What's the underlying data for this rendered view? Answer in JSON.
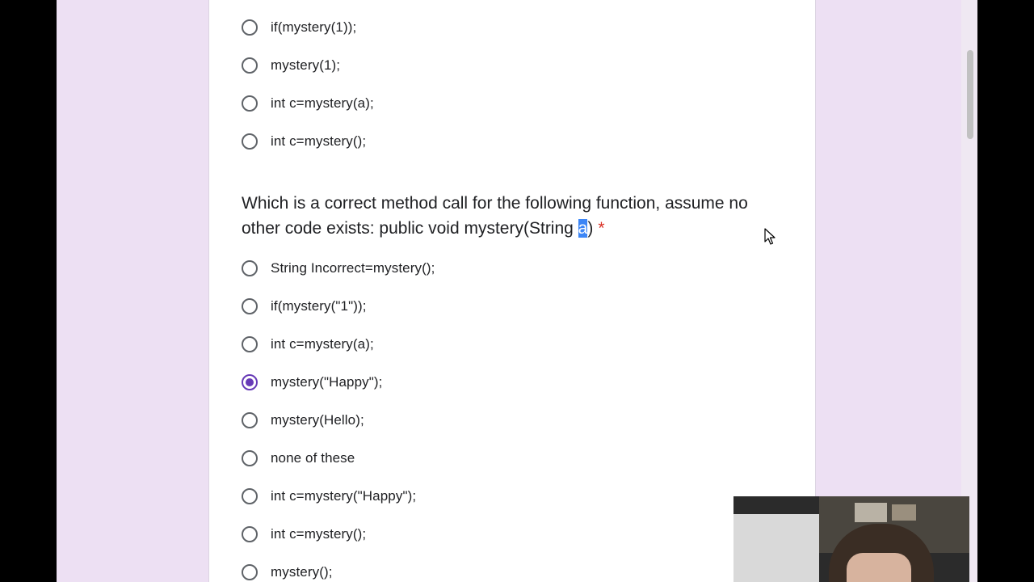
{
  "prev_question": {
    "options": [
      {
        "label": "if(mystery(1));",
        "checked": false
      },
      {
        "label": "mystery(1);",
        "checked": false
      },
      {
        "label": "int c=mystery(a);",
        "checked": false
      },
      {
        "label": "int c=mystery();",
        "checked": false
      }
    ]
  },
  "question": {
    "text_before": "Which is a correct method call for the following function, assume no other code exists: public void mystery(String ",
    "highlighted": "a",
    "text_after": ")",
    "required_mark": "*",
    "options": [
      {
        "label": "String Incorrect=mystery();",
        "checked": false
      },
      {
        "label": "if(mystery(\"1\"));",
        "checked": false
      },
      {
        "label": "int c=mystery(a);",
        "checked": false
      },
      {
        "label": "mystery(\"Happy\");",
        "checked": true
      },
      {
        "label": "mystery(Hello);",
        "checked": false
      },
      {
        "label": "none of these",
        "checked": false
      },
      {
        "label": "int c=mystery(\"Happy\");",
        "checked": false
      },
      {
        "label": "int c=mystery();",
        "checked": false
      },
      {
        "label": "mystery();",
        "checked": false
      }
    ]
  },
  "colors": {
    "accent": "#673ab7",
    "background": "#ede0f3",
    "required": "#d93025",
    "selection": "#3d86f6"
  }
}
